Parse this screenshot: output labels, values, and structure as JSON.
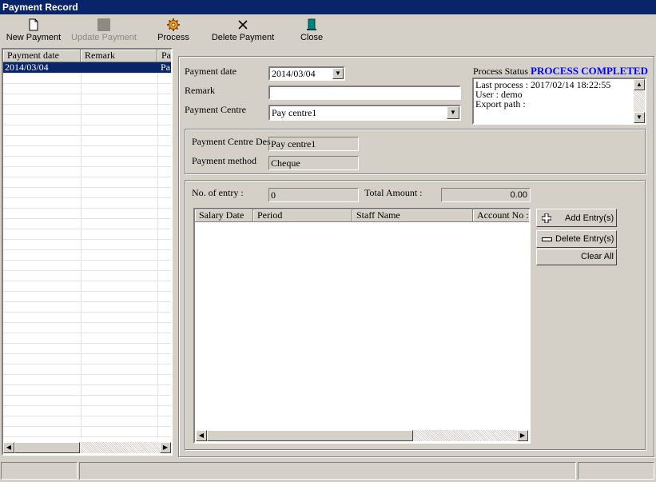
{
  "window": {
    "title": "Payment Record"
  },
  "toolbar": {
    "new_label": "New Payment",
    "update_label": "Update Payment",
    "process_label": "Process",
    "delete_label": "Delete Payment",
    "close_label": "Close"
  },
  "left_list": {
    "columns": [
      "Payment date",
      "Remark",
      "Pay"
    ],
    "rows": [
      {
        "date": "2014/03/04",
        "remark": "",
        "pay": "Pa"
      }
    ]
  },
  "form": {
    "payment_date_label": "Payment date",
    "payment_date_value": "2014/03/04",
    "remark_label": "Remark",
    "remark_value": "",
    "payment_centre_label": "Payment Centre",
    "payment_centre_value": "Pay centre1"
  },
  "process_status": {
    "label": "Process Status",
    "value": "PROCESS COMPLETED",
    "status_color": "#0000ff",
    "lines": [
      "Last process : 2017/02/14 18:22:55",
      "User : demo",
      "Export path :"
    ]
  },
  "centre_info": {
    "desc_label": "Payment Centre Des",
    "desc_value": "Pay centre1",
    "method_label": "Payment method",
    "method_value": "Cheque"
  },
  "entries": {
    "count_label": "No. of entry :",
    "count_value": "0",
    "total_label": "Total Amount :",
    "total_value": "0.00",
    "columns": [
      "Salary Date",
      "Period",
      "Staff Name",
      "Account No :"
    ],
    "add_label": "Add Entry(s)",
    "delete_label": "Delete Entry(s)",
    "clear_label": "Clear All"
  }
}
